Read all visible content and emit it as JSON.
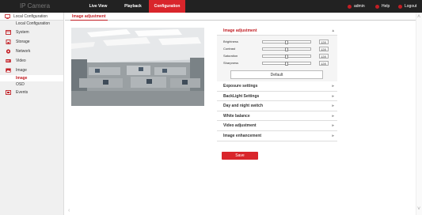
{
  "header": {
    "brand": "IP Camera",
    "nav": [
      "Live View",
      "Playback",
      "Configuration"
    ],
    "active_nav": "Configuration",
    "admin": "admin",
    "help": "Help",
    "logout": "Logout"
  },
  "sidebar": {
    "header": "Local Configuration",
    "local_config": "Local Configuration",
    "items": [
      {
        "label": "System",
        "icon": "system-icon"
      },
      {
        "label": "Storage",
        "icon": "storage-icon"
      },
      {
        "label": "Network",
        "icon": "network-icon"
      },
      {
        "label": "Video",
        "icon": "video-icon"
      },
      {
        "label": "Image",
        "icon": "image-icon"
      }
    ],
    "sub_items": [
      "Image",
      "OSD"
    ],
    "active_sub": "Image",
    "events": {
      "label": "Events",
      "icon": "events-icon"
    }
  },
  "tab": "Image adjustment",
  "panel": {
    "title": "Image adjustment",
    "sliders": [
      {
        "label": "Brightness",
        "value": "128",
        "level": 0.5
      },
      {
        "label": "Contrast",
        "value": "128",
        "level": 0.5
      },
      {
        "label": "Saturation",
        "value": "128",
        "level": 0.5
      },
      {
        "label": "Sharpness",
        "value": "128",
        "level": 0.5
      }
    ],
    "default_label": "Default",
    "sections": [
      "Exposure settings",
      "BackLight Settings",
      "Day and night switch",
      "White balance",
      "Video adjustment",
      "Image enhancement"
    ]
  },
  "save_label": "Save",
  "colors": {
    "accent": "#d9252b",
    "topbar": "#222222"
  }
}
